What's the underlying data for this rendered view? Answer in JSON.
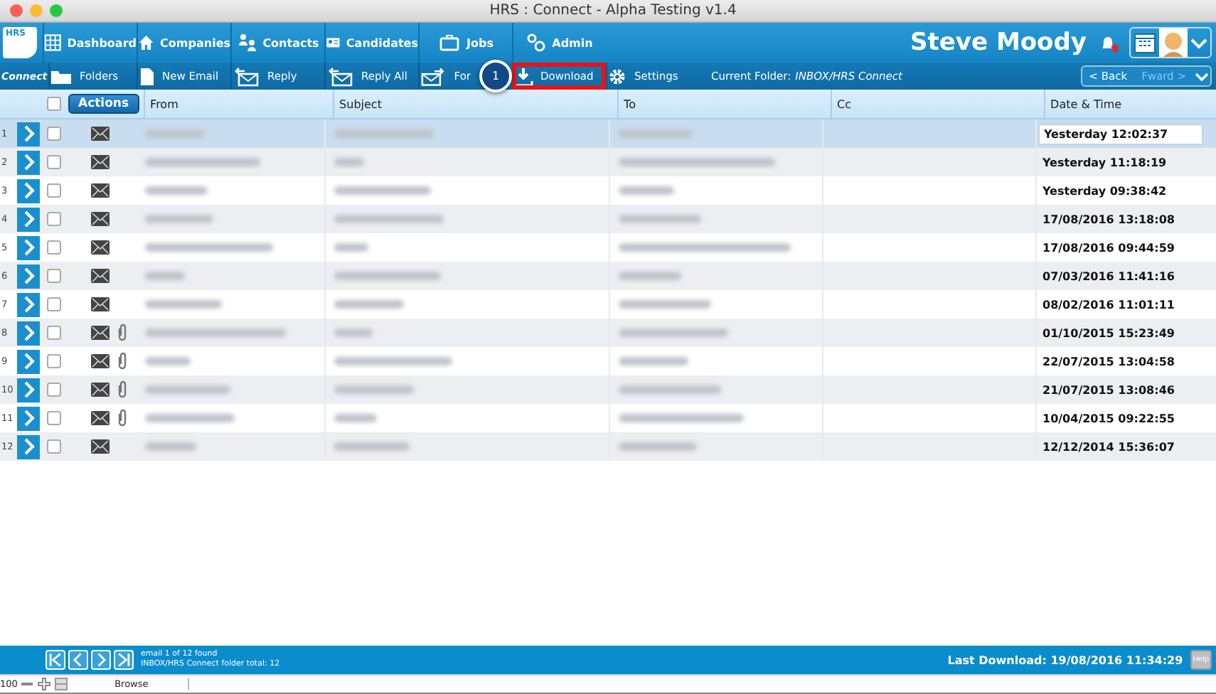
{
  "window": {
    "title": "HRS : Connect - Alpha Testing v1.4"
  },
  "logo": "HRS",
  "nav": [
    {
      "label": "Dashboard"
    },
    {
      "label": "Companies"
    },
    {
      "label": "Contacts"
    },
    {
      "label": "Candidates"
    },
    {
      "label": "Jobs"
    },
    {
      "label": "Admin"
    }
  ],
  "user": "Steve Moody",
  "toolbar": {
    "section": "Connect",
    "buttons": [
      {
        "label": "Folders",
        "highlighted": false
      },
      {
        "label": "New Email",
        "highlighted": false
      },
      {
        "label": "Reply",
        "highlighted": false
      },
      {
        "label": "Reply All",
        "highlighted": false
      },
      {
        "label": "For",
        "highlighted": false
      },
      {
        "label": "Download",
        "highlighted": true
      },
      {
        "label": "Settings",
        "highlighted": false
      }
    ],
    "current_folder_label": "Current Folder:",
    "current_folder": "INBOX/HRS Connect",
    "back": "< Back",
    "forward": "Fward >"
  },
  "callout": "1",
  "table": {
    "actions": "Actions",
    "all_checked": false,
    "columns": [
      "From",
      "Subject",
      "To",
      "Cc",
      "Date & Time"
    ],
    "rows": [
      {
        "number": "1",
        "selected": true,
        "checked": false,
        "attachment": false,
        "date": "Yesterday 12:02:37"
      },
      {
        "number": "2",
        "selected": false,
        "checked": false,
        "attachment": false,
        "date": "Yesterday 11:18:19"
      },
      {
        "number": "3",
        "selected": false,
        "checked": false,
        "attachment": false,
        "date": "Yesterday 09:38:42"
      },
      {
        "number": "4",
        "selected": false,
        "checked": false,
        "attachment": false,
        "date": "17/08/2016 13:18:08"
      },
      {
        "number": "5",
        "selected": false,
        "checked": false,
        "attachment": false,
        "date": "17/08/2016 09:44:59"
      },
      {
        "number": "6",
        "selected": false,
        "checked": false,
        "attachment": false,
        "date": "07/03/2016 11:41:16"
      },
      {
        "number": "7",
        "selected": false,
        "checked": false,
        "attachment": false,
        "date": "08/02/2016 11:01:11"
      },
      {
        "number": "8",
        "selected": false,
        "checked": false,
        "attachment": true,
        "date": "01/10/2015 15:23:49"
      },
      {
        "number": "9",
        "selected": false,
        "checked": false,
        "attachment": true,
        "date": "22/07/2015 13:04:58"
      },
      {
        "number": "10",
        "selected": false,
        "checked": false,
        "attachment": true,
        "date": "21/07/2015 13:08:46"
      },
      {
        "number": "11",
        "selected": false,
        "checked": false,
        "attachment": true,
        "date": "10/04/2015 09:22:55"
      },
      {
        "number": "12",
        "selected": false,
        "checked": false,
        "attachment": false,
        "date": "12/12/2014 15:36:07"
      }
    ]
  },
  "footer": {
    "found": "email 1 of 12 found",
    "total": "INBOX/HRS Connect folder total: 12",
    "last_download": "Last Download: 19/08/2016 11:34:29",
    "help": "Help"
  },
  "bottom": {
    "zoom": "100",
    "mode": "Browse"
  }
}
